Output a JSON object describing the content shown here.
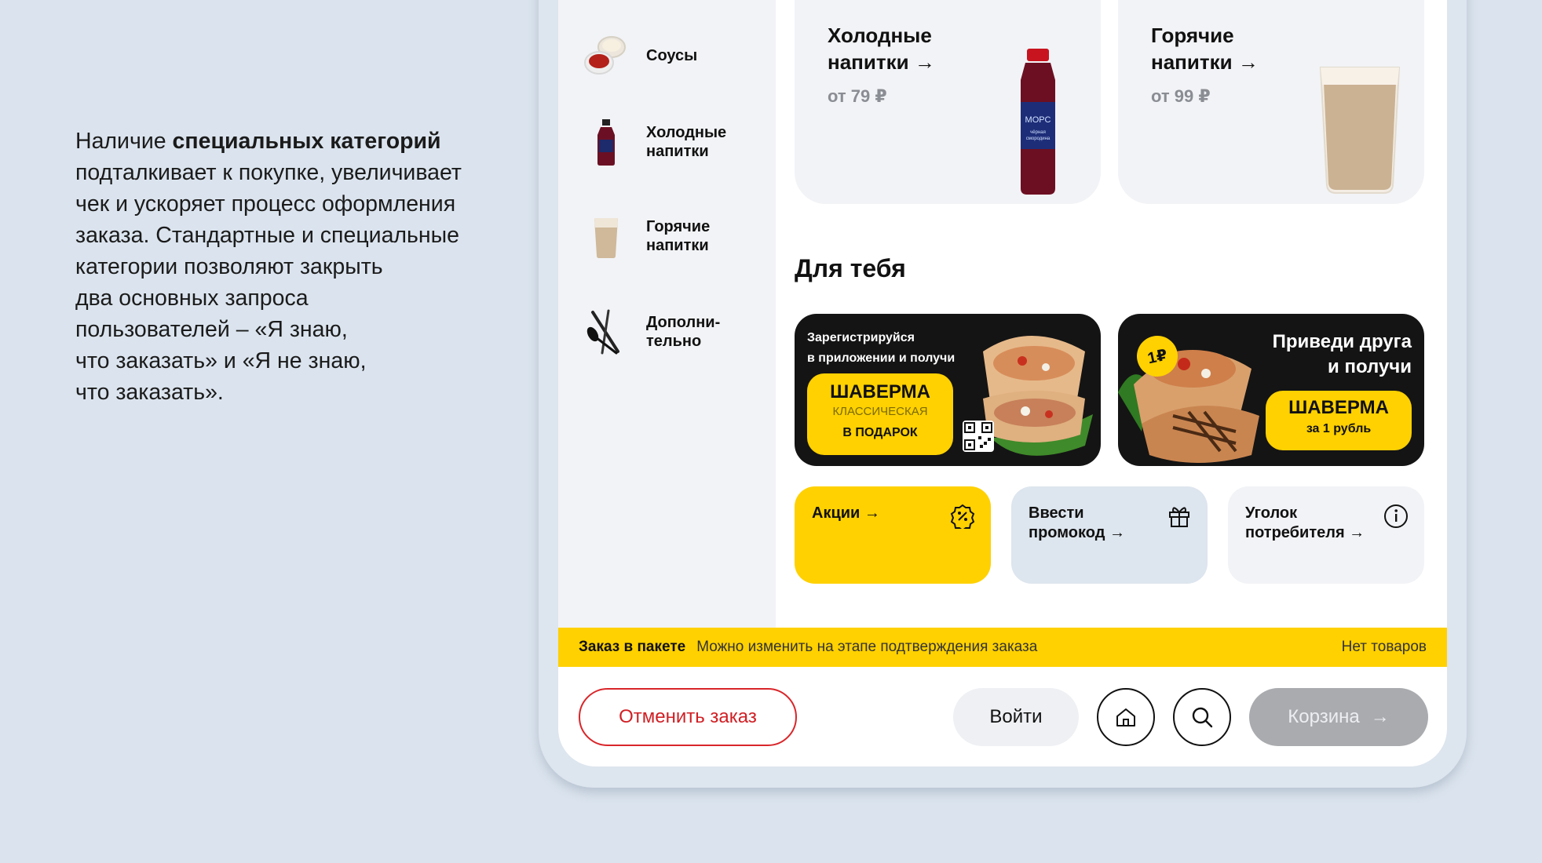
{
  "description": {
    "lines": [
      {
        "pre": "Наличие ",
        "bold": "специальных категорий",
        "post": ""
      },
      {
        "pre": "подталкивает к покупке, увеличивает",
        "bold": "",
        "post": ""
      },
      {
        "pre": "чек и ускоряет процесс оформления",
        "bold": "",
        "post": ""
      },
      {
        "pre": "заказа. Стандартные и специальные",
        "bold": "",
        "post": ""
      },
      {
        "pre": "категории позволяют закрыть",
        "bold": "",
        "post": ""
      },
      {
        "pre": "два основных запроса",
        "bold": "",
        "post": ""
      },
      {
        "pre": "пользователей – «Я знаю,",
        "bold": "",
        "post": ""
      },
      {
        "pre": "что заказать» и «Я не знаю,",
        "bold": "",
        "post": ""
      },
      {
        "pre": "что заказать».",
        "bold": "",
        "post": ""
      }
    ]
  },
  "sidebar": {
    "items": [
      {
        "label": "Соусы",
        "icon": "sauce-icon"
      },
      {
        "label": "Холодные\nнапитки",
        "icon": "cold-drink-icon"
      },
      {
        "label": "Горячие\nнапитки",
        "icon": "hot-drink-icon"
      },
      {
        "label": "Дополни-\nтельно",
        "icon": "cutlery-icon"
      }
    ]
  },
  "categories": [
    {
      "title": "Холодные\nнапитки",
      "arrow": "→",
      "price": "от 79 ₽",
      "image_label": "МОРС",
      "image_sub": "чёрная\nсмородина"
    },
    {
      "title": "Горячие\nнапитки",
      "arrow": "→",
      "price": "от 99 ₽"
    }
  ],
  "for_you": {
    "title": "Для тебя",
    "banner1": {
      "line1": "Зарегистрируйся",
      "line2": "в приложении и получи",
      "promo_title": "ШАВЕРМА",
      "promo_sub": "КЛАССИЧЕСКАЯ",
      "promo_note": "В ПОДАРОК"
    },
    "banner2": {
      "line1": "Приведи друга",
      "line2": "и получи",
      "promo_title": "ШАВЕРМА",
      "promo_note": "за 1 рубль",
      "badge": "1₽"
    }
  },
  "quick_links": [
    {
      "label": "Акции →",
      "icon": "percent-badge-icon",
      "color": "#ffd100"
    },
    {
      "label": "Ввести\nпромокод →",
      "icon": "gift-icon",
      "color": "#dde5ee"
    },
    {
      "label": "Уголок\nпотребителя →",
      "icon": "info-icon",
      "color": "#f2f3f6"
    }
  ],
  "order_bar": {
    "title": "Заказ в пакете",
    "hint": "Можно изменить на этапе подтверждения заказа",
    "status": "Нет товаров"
  },
  "bottom": {
    "cancel": "Отменить заказ",
    "login": "Войти",
    "cart": "Корзина",
    "cart_arrow": "→"
  },
  "colors": {
    "accent_yellow": "#ffd100",
    "cancel_red": "#d9262a",
    "background": "#dbe4ee"
  }
}
